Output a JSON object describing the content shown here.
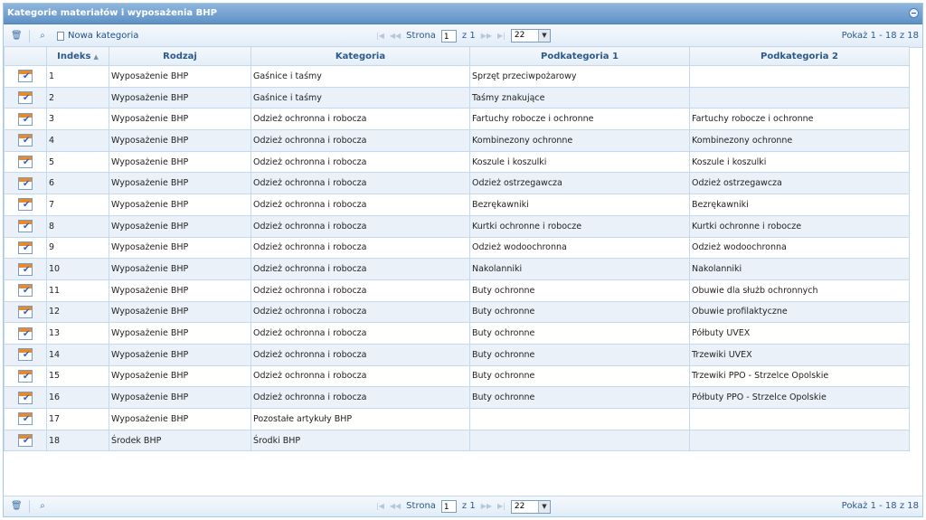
{
  "panel": {
    "title": "Kategorie materiałów i wyposażenia BHP"
  },
  "toolbar": {
    "new_label": "Nowa kategoria",
    "page_label": "Strona",
    "page_value": "1",
    "of_label": "z 1",
    "rows_value": "22",
    "showing": "Pokaż 1 - 18 z 18"
  },
  "columns": [
    "Indeks",
    "Rodzaj",
    "Kategoria",
    "Podkategoria 1",
    "Podkategoria 2"
  ],
  "rows": [
    [
      "1",
      "Wyposażenie BHP",
      "Gaśnice i taśmy",
      "Sprzęt przeciwpożarowy",
      ""
    ],
    [
      "2",
      "Wyposażenie BHP",
      "Gaśnice i taśmy",
      "Taśmy znakujące",
      ""
    ],
    [
      "3",
      "Wyposażenie BHP",
      "Odzież ochronna i robocza",
      "Fartuchy robocze i ochronne",
      "Fartuchy robocze i ochronne"
    ],
    [
      "4",
      "Wyposażenie BHP",
      "Odzież ochronna i robocza",
      "Kombinezony ochronne",
      "Kombinezony ochronne"
    ],
    [
      "5",
      "Wyposażenie BHP",
      "Odzież ochronna i robocza",
      "Koszule i koszulki",
      "Koszule i koszulki"
    ],
    [
      "6",
      "Wyposażenie BHP",
      "Odzież ochronna i robocza",
      "Odzież ostrzegawcza",
      "Odzież ostrzegawcza"
    ],
    [
      "7",
      "Wyposażenie BHP",
      "Odzież ochronna i robocza",
      "Bezrękawniki",
      "Bezrękawniki"
    ],
    [
      "8",
      "Wyposażenie BHP",
      "Odzież ochronna i robocza",
      "Kurtki ochronne i robocze",
      "Kurtki ochronne i robocze"
    ],
    [
      "9",
      "Wyposażenie BHP",
      "Odzież ochronna i robocza",
      "Odzież wodoochronna",
      "Odzież wodoochronna"
    ],
    [
      "10",
      "Wyposażenie BHP",
      "Odzież ochronna i robocza",
      "Nakolanniki",
      "Nakolanniki"
    ],
    [
      "11",
      "Wyposażenie BHP",
      "Odzież ochronna i robocza",
      "Buty ochronne",
      "Obuwie dla służb ochronnych"
    ],
    [
      "12",
      "Wyposażenie BHP",
      "Odzież ochronna i robocza",
      "Buty ochronne",
      "Obuwie profilaktyczne"
    ],
    [
      "13",
      "Wyposażenie BHP",
      "Odzież ochronna i robocza",
      "Buty ochronne",
      "Półbuty UVEX"
    ],
    [
      "14",
      "Wyposażenie BHP",
      "Odzież ochronna i robocza",
      "Buty ochronne",
      "Trzewiki UVEX"
    ],
    [
      "15",
      "Wyposażenie BHP",
      "Odzież ochronna i robocza",
      "Buty ochronne",
      "Trzewiki PPO - Strzelce Opolskie"
    ],
    [
      "16",
      "Wyposażenie BHP",
      "Odzież ochronna i robocza",
      "Buty ochronne",
      "Półbuty PPO - Strzelce Opolskie"
    ],
    [
      "17",
      "Wyposażenie BHP",
      "Pozostałe artykuły BHP",
      "",
      ""
    ],
    [
      "18",
      "Środek BHP",
      "Środki BHP",
      "",
      ""
    ]
  ],
  "icons": {
    "delete": "trash-icon",
    "search": "search-icon",
    "new": "document-icon",
    "edit": "edit-row-icon",
    "collapse": "collapse-icon"
  }
}
